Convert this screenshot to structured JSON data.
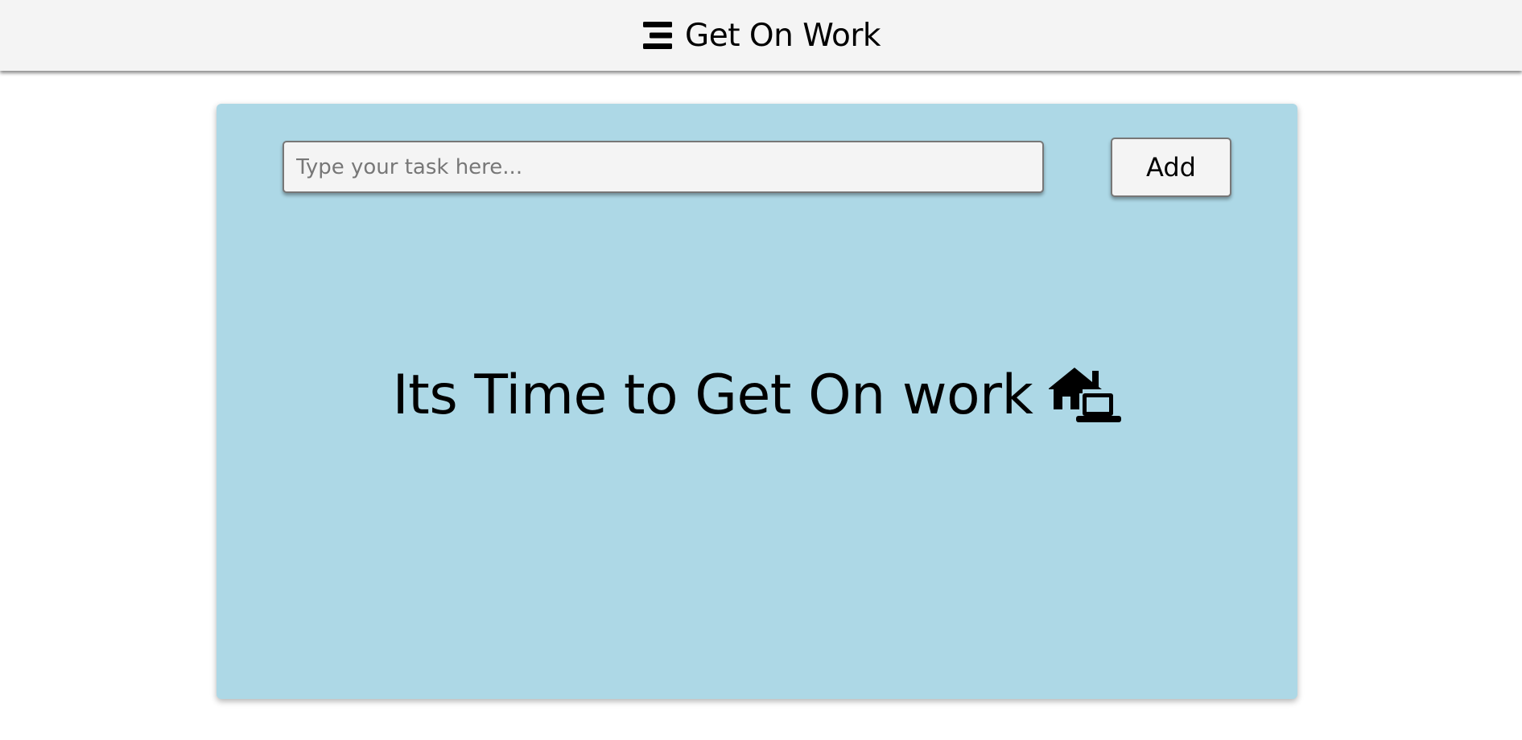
{
  "header": {
    "title": "Get On Work",
    "icon": "bars-staggered-icon"
  },
  "task_form": {
    "input_value": "",
    "input_placeholder": "Type your task here...",
    "add_label": "Add"
  },
  "empty_state": {
    "message": "Its Time to Get On work",
    "icon": "house-laptop-icon"
  },
  "colors": {
    "header_bg": "#f4f4f4",
    "card_bg": "#add8e6",
    "control_bg": "#f4f4f4",
    "text": "#000000"
  }
}
